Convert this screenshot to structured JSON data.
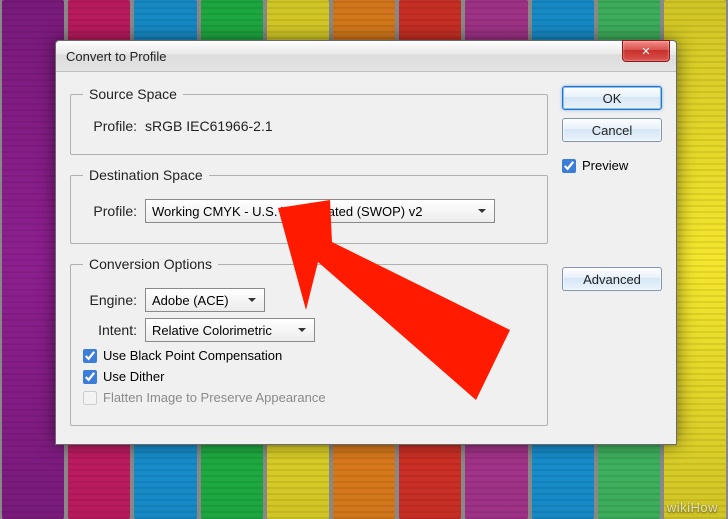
{
  "background": {
    "plank_colors": [
      "#8e1f90",
      "#d61f6d",
      "#1aa0e6",
      "#22c24a",
      "#f5e72c",
      "#f58a1f",
      "#e8362a",
      "#b83a9b",
      "#1aa0e6",
      "#46c96a",
      "#f5e72c"
    ]
  },
  "window": {
    "title": "Convert to Profile",
    "close_glyph": "✕"
  },
  "source_space": {
    "legend": "Source Space",
    "profile_label": "Profile:",
    "profile_value": "sRGB IEC61966-2.1"
  },
  "destination_space": {
    "legend": "Destination Space",
    "profile_label": "Profile:",
    "profile_value": "Working CMYK - U.S. Web Coated (SWOP) v2"
  },
  "conversion_options": {
    "legend": "Conversion Options",
    "engine_label": "Engine:",
    "engine_value": "Adobe (ACE)",
    "intent_label": "Intent:",
    "intent_value": "Relative Colorimetric",
    "black_point_label": "Use Black Point Compensation",
    "black_point_checked": true,
    "dither_label": "Use Dither",
    "dither_checked": true,
    "flatten_label": "Flatten Image to Preserve Appearance",
    "flatten_checked": false,
    "flatten_enabled": false
  },
  "sidebar": {
    "ok_label": "OK",
    "cancel_label": "Cancel",
    "preview_label": "Preview",
    "preview_checked": true,
    "advanced_label": "Advanced"
  },
  "annotation": {
    "arrow_color": "#ff1a00"
  },
  "watermark": "wikiHow"
}
